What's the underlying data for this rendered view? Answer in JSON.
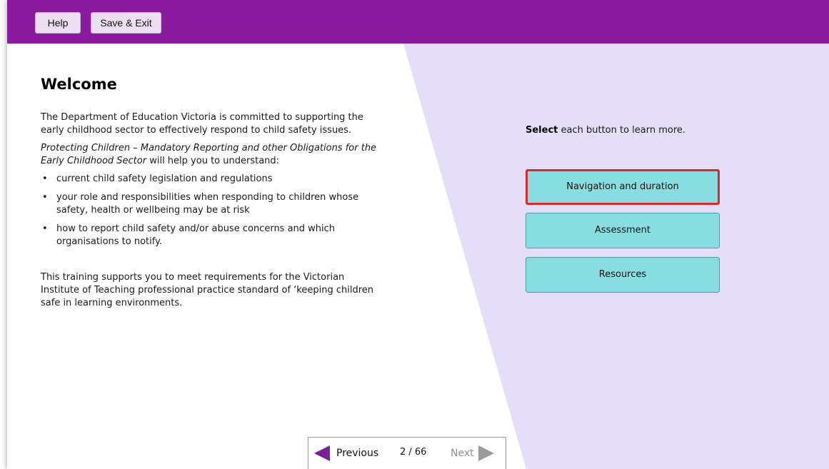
{
  "toolbar": {
    "help_label": "Help",
    "save_exit_label": "Save & Exit"
  },
  "main": {
    "title": "Welcome",
    "intro": "The Department of Education Victoria is committed to supporting the early childhood sector to effectively respond to child safety issues.",
    "course_name": "Protecting Children – Mandatory Reporting and other Obligations for the Early Childhood Sector",
    "course_suffix": " will help you to understand:",
    "bullets": [
      "current child safety legislation and regulations",
      "your role and responsibilities when responding to children whose safety, health or wellbeing may be at risk",
      "how to report child safety and/or abuse concerns and which organisations to notify."
    ],
    "closing": "This training supports you to meet requirements for the Victorian Institute of Teaching professional practice standard of ‘keeping children safe in learning environments."
  },
  "side": {
    "select_bold": "Select",
    "select_rest": " each button to learn more.",
    "buttons": [
      {
        "label": "Navigation and duration"
      },
      {
        "label": "Assessment"
      },
      {
        "label": "Resources"
      }
    ]
  },
  "pager": {
    "previous_label": "Previous",
    "page_count": "2 / 66",
    "next_label": "Next"
  },
  "colors": {
    "header_bg": "#8a1a9e",
    "panel_bg": "#e4defa",
    "button_bg": "#88dde0",
    "highlight_border": "#e0282a",
    "prev_arrow": "#7a1f96"
  }
}
